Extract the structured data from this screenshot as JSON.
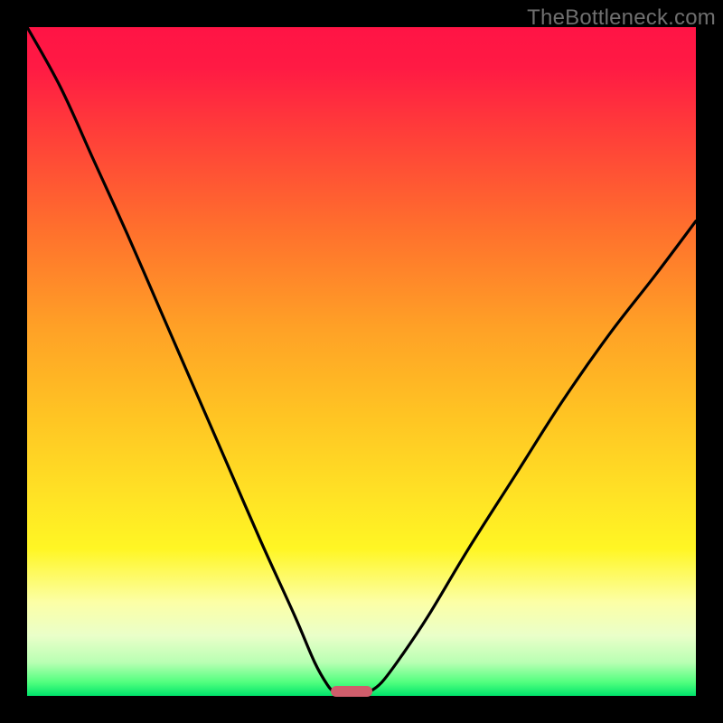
{
  "watermark": "TheBottleneck.com",
  "chart_data": {
    "type": "line",
    "title": "",
    "xlabel": "",
    "ylabel": "",
    "xlim": [
      0,
      100
    ],
    "ylim": [
      0,
      100
    ],
    "grid": false,
    "legend": false,
    "background_gradient": {
      "direction": "vertical",
      "stops": [
        {
          "pos": 0,
          "color": "#ff1445"
        },
        {
          "pos": 30,
          "color": "#ff6f2d"
        },
        {
          "pos": 58,
          "color": "#ffc423"
        },
        {
          "pos": 78,
          "color": "#fff624"
        },
        {
          "pos": 95,
          "color": "#b9ffb3"
        },
        {
          "pos": 100,
          "color": "#00e46b"
        }
      ]
    },
    "series": [
      {
        "name": "left-curve",
        "color": "#000000",
        "x": [
          0,
          5,
          10,
          15,
          20,
          25,
          30,
          35,
          40,
          43,
          45,
          46
        ],
        "values": [
          100,
          91,
          80,
          69,
          57.5,
          46,
          34.5,
          23,
          12,
          5,
          1.5,
          0.5
        ]
      },
      {
        "name": "right-curve",
        "color": "#000000",
        "x": [
          51,
          53,
          56,
          60,
          66,
          73,
          80,
          87,
          94,
          100
        ],
        "values": [
          0.5,
          2,
          6,
          12,
          22,
          33,
          44,
          54,
          63,
          71
        ]
      }
    ],
    "marker": {
      "name": "bottom-pill",
      "color": "#cf5d6b",
      "x_center": 48.5,
      "width_pct": 6.2
    }
  }
}
